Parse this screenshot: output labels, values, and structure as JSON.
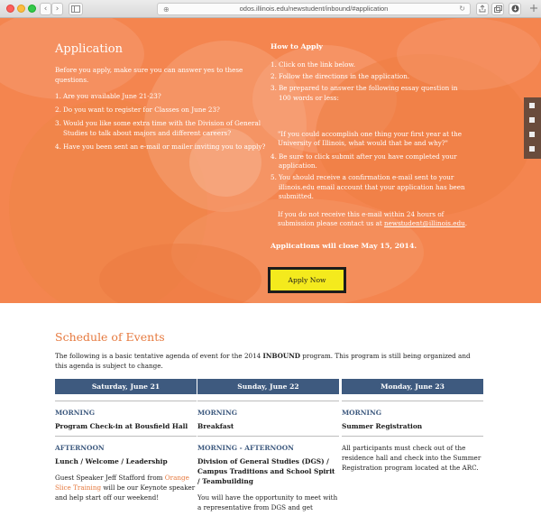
{
  "browser": {
    "url": "odos.illinois.edu/newstudent/inbound/#application",
    "back": "‹",
    "forward": "›"
  },
  "application": {
    "title": "Application",
    "intro": "Before you apply, make sure you can answer yes to these questions.",
    "questions": [
      {
        "num": "1.",
        "text": "Are you available June 21-23?"
      },
      {
        "num": "2.",
        "text": "Do you want to register for Classes on June 23?"
      },
      {
        "num": "3.",
        "text": "Would you like some extra time with the Division of General Studies to talk about majors and different careers?"
      },
      {
        "num": "4.",
        "text": "Have you been sent an e-mail or mailer inviting you to apply?"
      }
    ]
  },
  "how_to_apply": {
    "title": "How to Apply",
    "steps": [
      {
        "num": "1.",
        "text": "Click on the link below."
      },
      {
        "num": "2.",
        "text": "Follow the directions in the application."
      },
      {
        "num": "3.",
        "text": "Be prepared to answer the following essay question in 100 words or less:"
      }
    ],
    "quote": "\"If you could accomplish one thing your first year at the University of Illinois, what would that be and why?\"",
    "steps_after": [
      {
        "num": "4.",
        "text": "Be sure to click submit after you have completed your application."
      },
      {
        "num": "5.",
        "text": "You should receive a confirmation e-mail sent to your illinois.edu email account that your application has been submitted."
      }
    ],
    "note_prefix": "If you do not receive this e-mail within 24 hours of submission please contact us at ",
    "note_email": "newstudent@illinois.edu",
    "note_suffix": ".",
    "closing": "Applications will close May 15, 2014.",
    "apply_button": "Apply Now"
  },
  "schedule": {
    "title": "Schedule of Events",
    "intro_prefix": "The following is a basic tentative agenda of event for the 2014 ",
    "intro_bold": "INBOUND",
    "intro_suffix": " program. This program is still being organized and this agenda is subject to change.",
    "days": [
      {
        "day": "Saturday, June 21",
        "morning_label": "MORNING",
        "morning_event": "Program Check-in at Bousfield Hall",
        "afternoon_label": "AFTERNOON",
        "afternoon_event": "Lunch / Welcome / Leadership",
        "desc_prefix": "Guest Speaker Jeff Stafford from ",
        "desc_link": "Orange Slice Training",
        "desc_suffix": " will be our Keynote speaker and help start off our weekend!"
      },
      {
        "day": "Sunday, June 22",
        "morning_label": "MORNING",
        "morning_event": "Breakfast",
        "afternoon_label": "MORNING - AFTERNOON",
        "afternoon_event": "Division of General Studies (DGS) / Campus Traditions and School Spirit / Teambuilding",
        "desc": "You will have the opportunity to meet with a representative from DGS and get"
      },
      {
        "day": "Monday, June 23",
        "morning_label": "MORNING",
        "morning_event": "Summer Registration",
        "desc": "All participants must check out of the residence hall and check into the Summer Registration program located at the ARC."
      }
    ]
  },
  "colors": {
    "hero_orange": "#f4854f",
    "accent_orange": "#e6793e",
    "navy": "#3e5a7f",
    "button_yellow": "#f4ea1d"
  }
}
